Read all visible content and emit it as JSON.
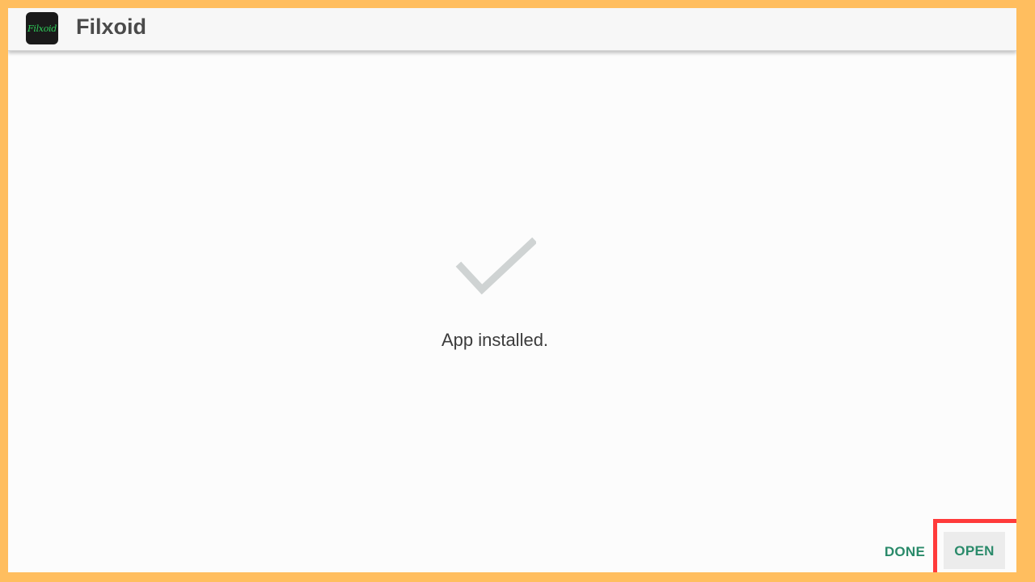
{
  "app_bar": {
    "icon_text": "Filxoid",
    "title": "Filxoid"
  },
  "status": {
    "icon": "checkmark-icon",
    "message": "App installed."
  },
  "actions": {
    "done_label": "DONE",
    "open_label": "OPEN"
  },
  "colors": {
    "frame": "#ffbe5f",
    "accent": "#2a8a6a",
    "highlight": "#ff3b3b",
    "check": "#cfd3d3"
  }
}
